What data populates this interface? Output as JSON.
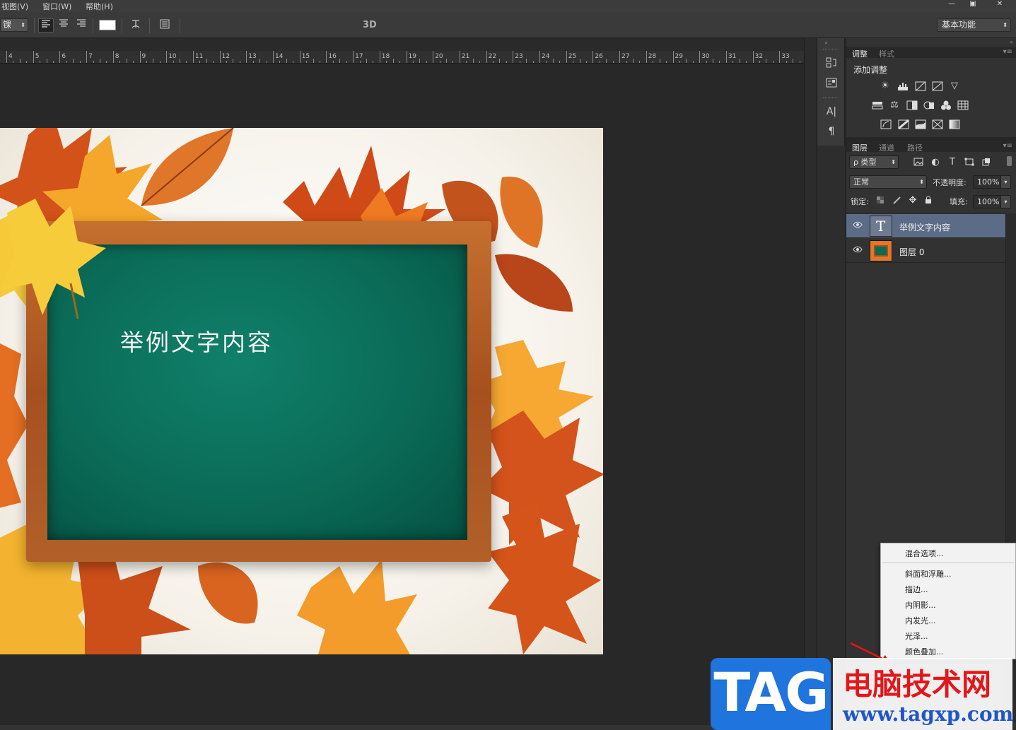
{
  "menubar": {
    "items": [
      "视图(V)",
      "窗口(W)",
      "帮助(H)"
    ]
  },
  "window_controls": {
    "minimize": "—",
    "restore": "▣",
    "close": "✕"
  },
  "options_bar": {
    "font_size_select": "锞",
    "mode_3d": "3D",
    "workspace_select": "基本功能"
  },
  "ruler": {
    "ticks": [
      "4",
      "5",
      "6",
      "7",
      "8",
      "9",
      "10",
      "11",
      "12",
      "13",
      "14",
      "15",
      "16",
      "17",
      "18",
      "19",
      "20",
      "21",
      "22",
      "23",
      "24",
      "25",
      "26",
      "27",
      "28",
      "29",
      "30",
      "31",
      "32",
      "33"
    ]
  },
  "canvas": {
    "text_layer_content": "举例文字内容"
  },
  "adjustments_panel": {
    "tabs": [
      "调整",
      "样式"
    ],
    "active_tab": "调整",
    "title": "添加调整"
  },
  "layers_panel": {
    "tabs": [
      "图层",
      "通道",
      "路径"
    ],
    "active_tab": "图层",
    "filter_kind": "ρ 类型",
    "blend_mode": "正常",
    "opacity_label": "不透明度:",
    "opacity_value": "100%",
    "lock_label": "锁定:",
    "fill_label": "填充:",
    "fill_value": "100%",
    "layers": [
      {
        "name": "举例文字内容",
        "type": "text",
        "selected": true
      },
      {
        "name": "图层 0",
        "type": "image",
        "selected": false
      }
    ]
  },
  "context_menu": {
    "items": [
      "混合选项...",
      "斜面和浮雕...",
      "描边...",
      "内阴影...",
      "内发光...",
      "光泽...",
      "颜色叠加..."
    ]
  },
  "watermark": {
    "tag": "TAG",
    "site_name": "电脑技术网",
    "url": "www.tagxp.com"
  },
  "colors": {
    "selected_layer": "#5c6c87",
    "board_green": "#0a6b57",
    "frame_wood": "#a6501f",
    "watermark_blue": "#1f74dd",
    "watermark_red": "#e3171a"
  }
}
